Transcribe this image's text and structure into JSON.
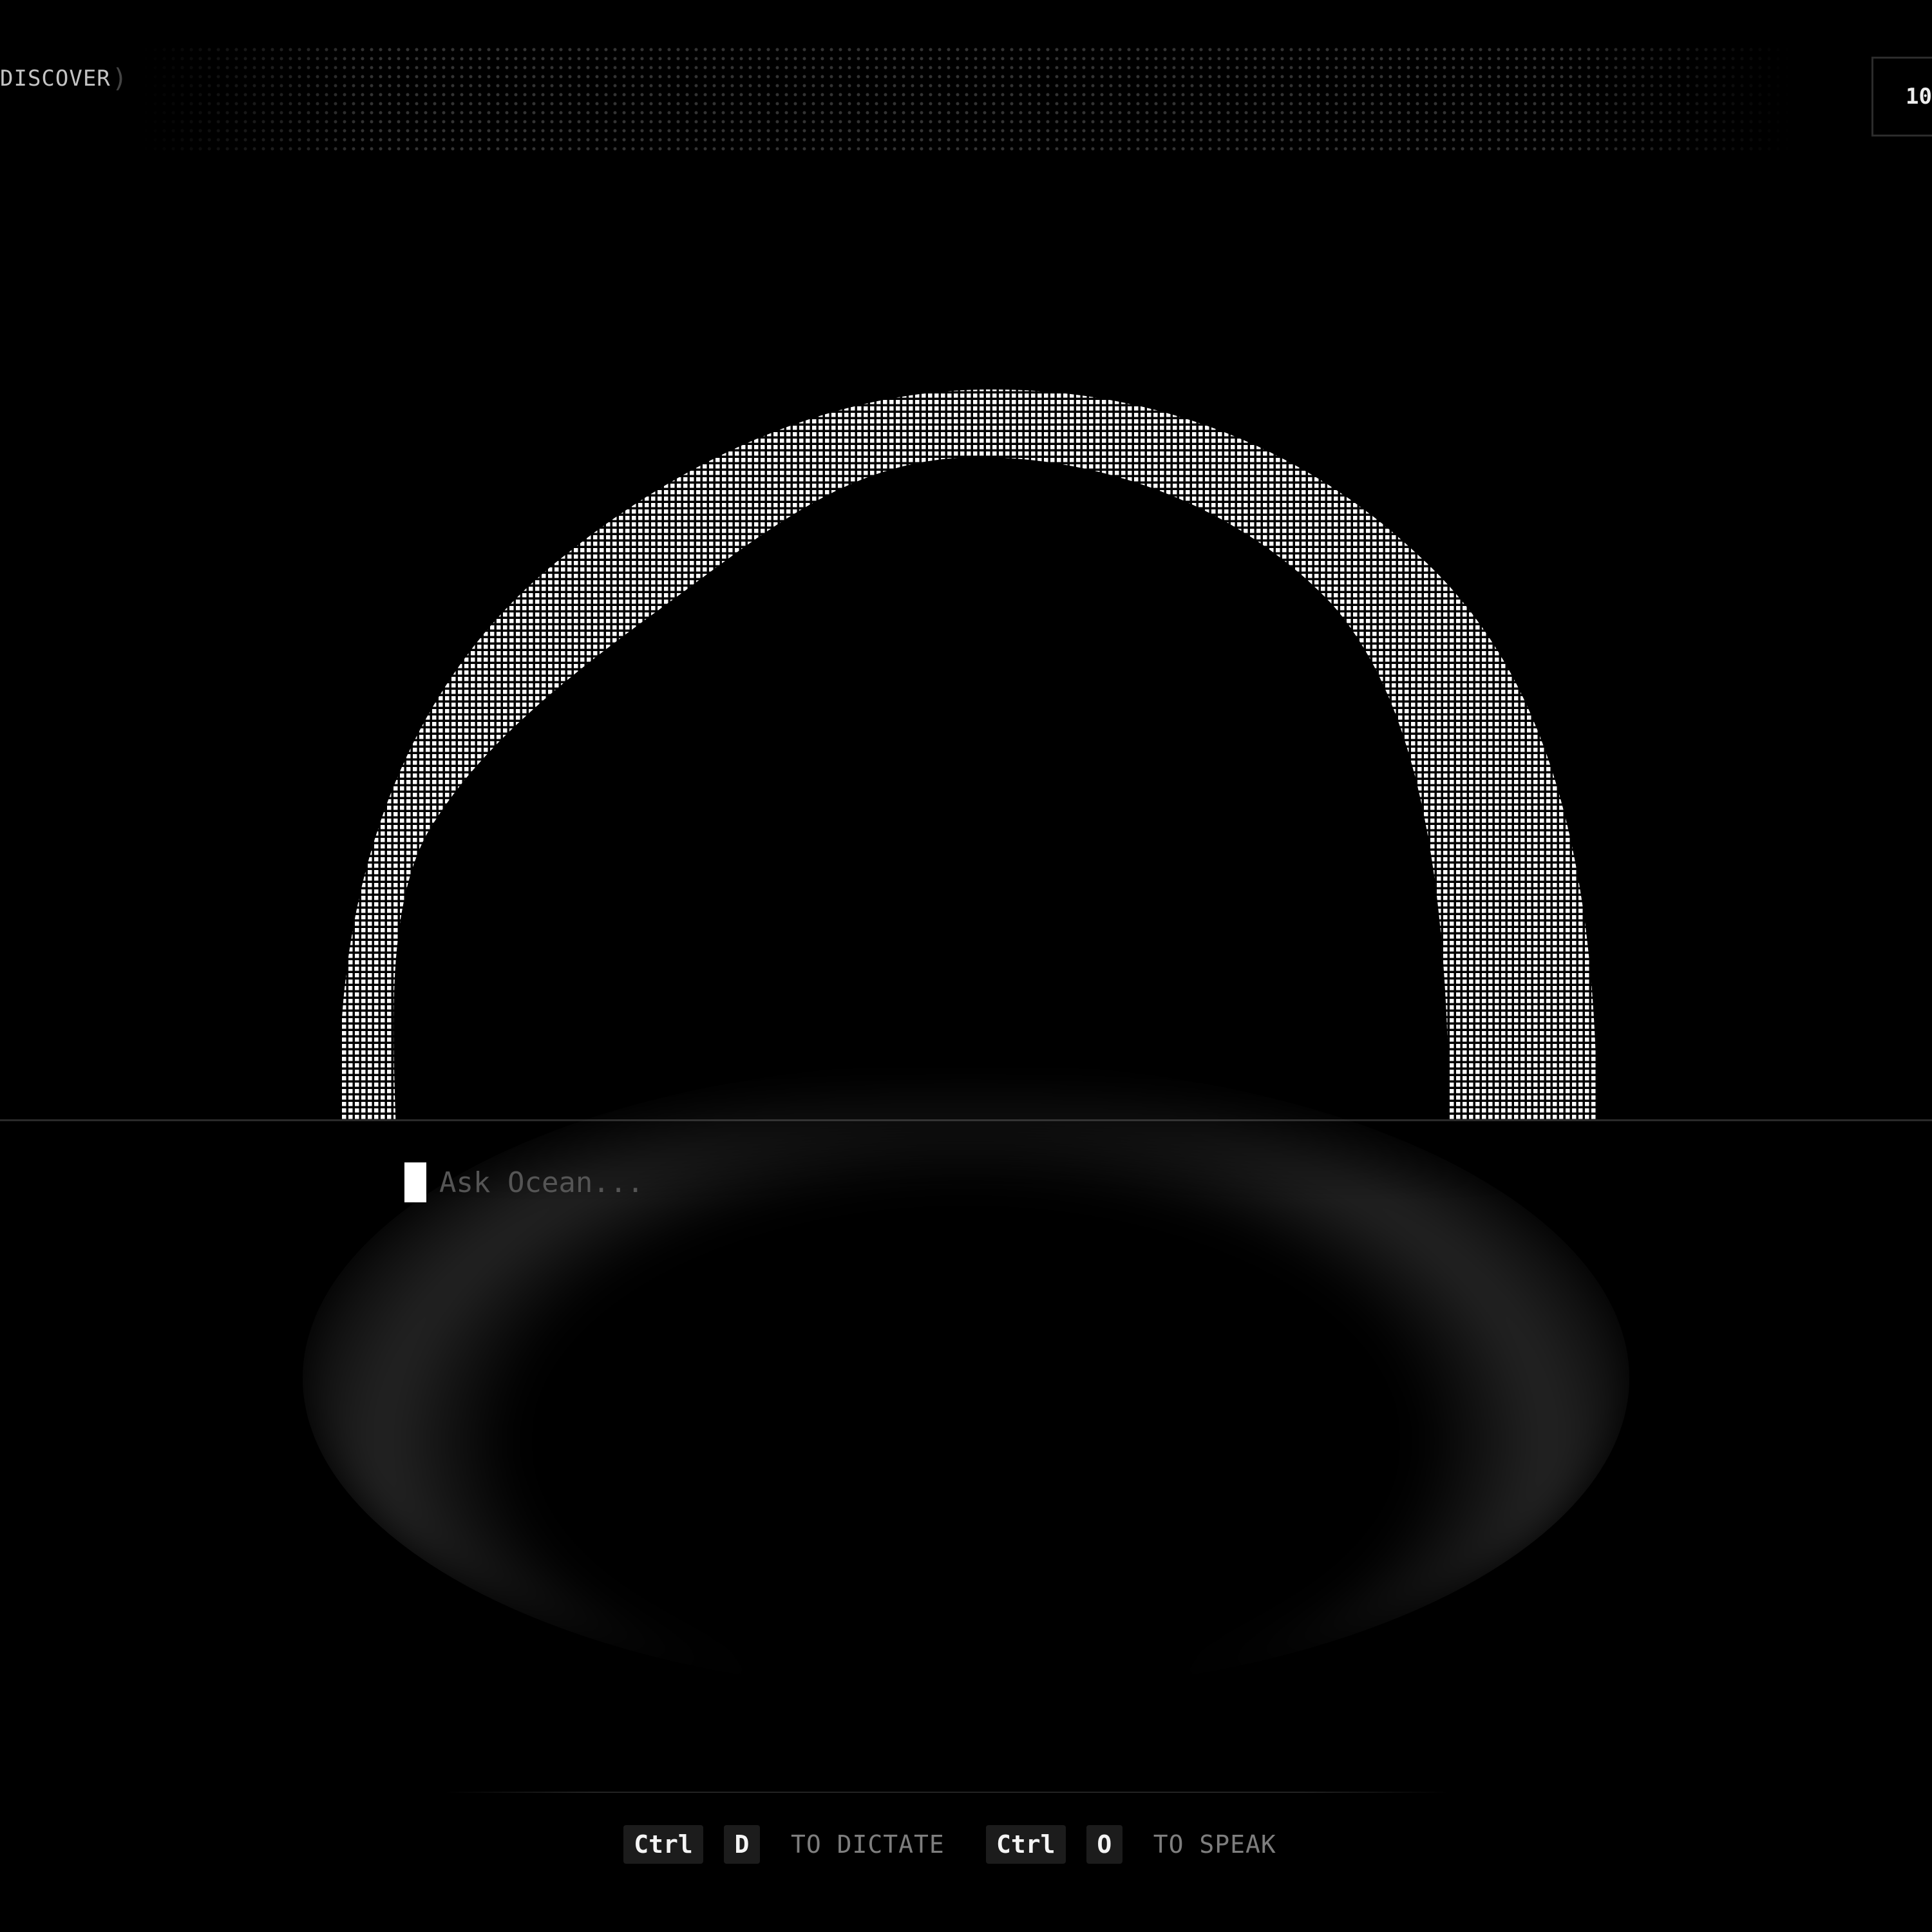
{
  "nav": {
    "discover_label": "DISCOVER",
    "bracket_right": ")"
  },
  "top_right": {
    "value": "10"
  },
  "prompt": {
    "placeholder": "Ask Ocean..."
  },
  "shortcuts": [
    {
      "modifier": "Ctrl",
      "key": "D",
      "action": "TO DICTATE"
    },
    {
      "modifier": "Ctrl",
      "key": "O",
      "action": "TO SPEAK"
    }
  ],
  "icons": {
    "orb": "dotted-arch-orb-icon",
    "caret": "text-caret-icon"
  },
  "colors": {
    "background": "#000000",
    "dots": "#ffffff",
    "divider": "#2a2a2a",
    "placeholder": "#555555",
    "label": "#7e7e7e"
  }
}
